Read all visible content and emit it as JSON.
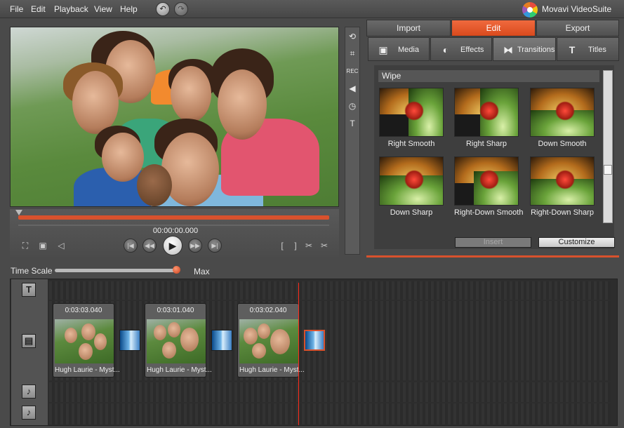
{
  "menu": {
    "items": [
      "File",
      "Edit",
      "Playback",
      "View",
      "Help"
    ],
    "brand": "Movavi VideoSuite"
  },
  "tabs": {
    "top": [
      "Import",
      "Edit",
      "Export"
    ],
    "active_top": "Edit",
    "sub": [
      "Media",
      "Effects",
      "Transitions",
      "Titles"
    ],
    "active_sub": "Transitions"
  },
  "player": {
    "timecode": "00:00:00.000",
    "progress_fraction": 0.0
  },
  "side_tools": {
    "rec_label": "REC",
    "text_label": "T"
  },
  "transitions": {
    "group": "Wipe",
    "items": [
      "Right Smooth",
      "Right Sharp",
      "Down Smooth",
      "Down Sharp",
      "Right-Down Smooth",
      "Right-Down Sharp"
    ],
    "insert_label": "Insert",
    "customize_label": "Customize"
  },
  "timeline": {
    "scale_label": "Time Scale",
    "scale_max_label": "Max",
    "scale_value": 1.0,
    "text_track_icon": "T",
    "clips": [
      {
        "duration": "0:03:03.040",
        "name": "Hugh Laurie - Myst..."
      },
      {
        "duration": "0:03:01.040",
        "name": "Hugh Laurie - Myst..."
      },
      {
        "duration": "0:03:02.040",
        "name": "Hugh Laurie - Myst..."
      }
    ]
  },
  "colors": {
    "accent": "#d8512d",
    "playhead": "#ff2a1a"
  }
}
